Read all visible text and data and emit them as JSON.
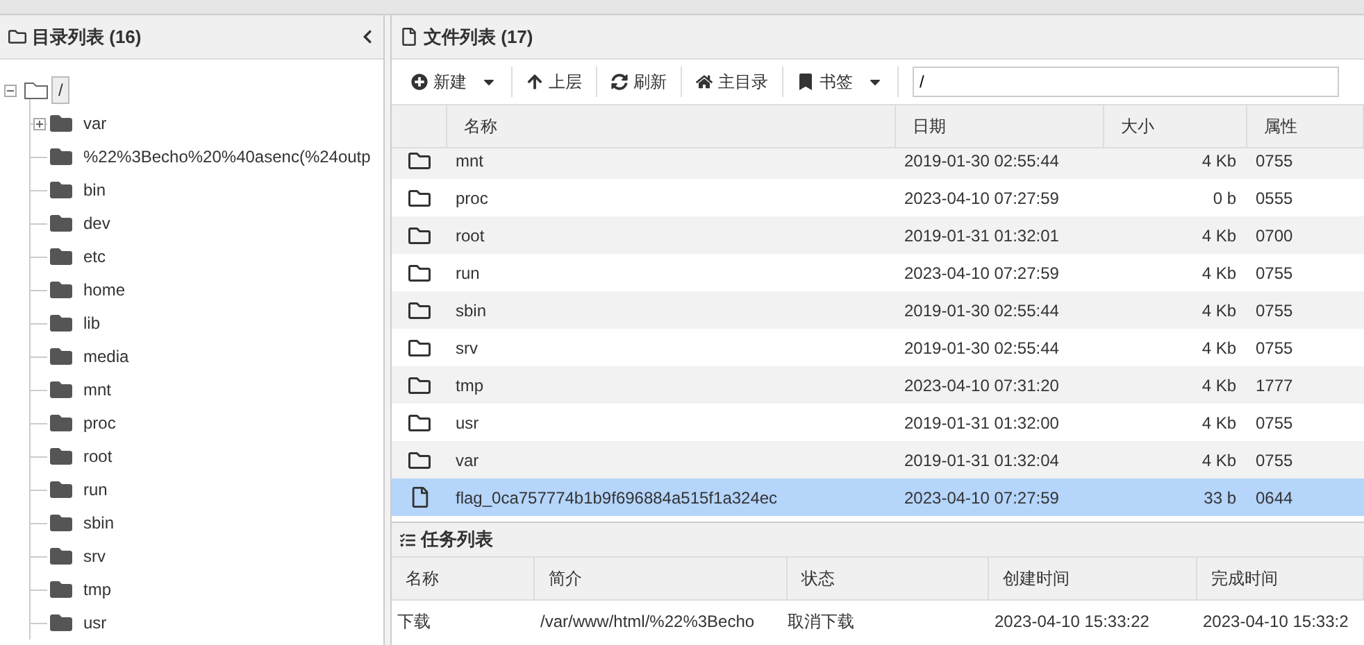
{
  "tree_panel": {
    "title": "目录列表 (16)",
    "root": {
      "label": "/",
      "expanded": true,
      "selected": true,
      "children": [
        {
          "label": "var",
          "kind": "collapsed"
        },
        {
          "label": "%22%3Becho%20%40asenc(%24outp",
          "kind": "leaf"
        },
        {
          "label": "bin",
          "kind": "leaf"
        },
        {
          "label": "dev",
          "kind": "leaf"
        },
        {
          "label": "etc",
          "kind": "leaf"
        },
        {
          "label": "home",
          "kind": "leaf"
        },
        {
          "label": "lib",
          "kind": "leaf"
        },
        {
          "label": "media",
          "kind": "leaf"
        },
        {
          "label": "mnt",
          "kind": "leaf"
        },
        {
          "label": "proc",
          "kind": "leaf"
        },
        {
          "label": "root",
          "kind": "leaf"
        },
        {
          "label": "run",
          "kind": "leaf"
        },
        {
          "label": "sbin",
          "kind": "leaf"
        },
        {
          "label": "srv",
          "kind": "leaf"
        },
        {
          "label": "tmp",
          "kind": "leaf"
        },
        {
          "label": "usr",
          "kind": "leaf"
        }
      ]
    }
  },
  "file_panel": {
    "title": "文件列表 (17)",
    "toolbar": [
      {
        "label": "新建",
        "kind": "new",
        "dropdown": true
      },
      {
        "label": "上层",
        "kind": "up",
        "dropdown": false
      },
      {
        "label": "刷新",
        "kind": "refresh",
        "dropdown": false
      },
      {
        "label": "主目录",
        "kind": "home",
        "dropdown": false
      },
      {
        "label": "书签",
        "kind": "bookmark",
        "dropdown": true
      }
    ],
    "path": "/",
    "columns": [
      "名称",
      "日期",
      "大小",
      "属性"
    ],
    "rows": [
      {
        "kind": "folder",
        "name": "mnt",
        "date": "2019-01-30 02:55:44",
        "size": "4 Kb",
        "mode": "0755",
        "selected": false
      },
      {
        "kind": "folder",
        "name": "proc",
        "date": "2023-04-10 07:27:59",
        "size": "0 b",
        "mode": "0555",
        "selected": false
      },
      {
        "kind": "folder",
        "name": "root",
        "date": "2019-01-31 01:32:01",
        "size": "4 Kb",
        "mode": "0700",
        "selected": false
      },
      {
        "kind": "folder",
        "name": "run",
        "date": "2023-04-10 07:27:59",
        "size": "4 Kb",
        "mode": "0755",
        "selected": false
      },
      {
        "kind": "folder",
        "name": "sbin",
        "date": "2019-01-30 02:55:44",
        "size": "4 Kb",
        "mode": "0755",
        "selected": false
      },
      {
        "kind": "folder",
        "name": "srv",
        "date": "2019-01-30 02:55:44",
        "size": "4 Kb",
        "mode": "0755",
        "selected": false
      },
      {
        "kind": "folder",
        "name": "tmp",
        "date": "2023-04-10 07:31:20",
        "size": "4 Kb",
        "mode": "1777",
        "selected": false
      },
      {
        "kind": "folder",
        "name": "usr",
        "date": "2019-01-31 01:32:00",
        "size": "4 Kb",
        "mode": "0755",
        "selected": false
      },
      {
        "kind": "folder",
        "name": "var",
        "date": "2019-01-31 01:32:04",
        "size": "4 Kb",
        "mode": "0755",
        "selected": false
      },
      {
        "kind": "file",
        "name": "flag_0ca757774b1b9f696884a515f1a324ec",
        "date": "2023-04-10 07:27:59",
        "size": "33 b",
        "mode": "0644",
        "selected": true
      }
    ]
  },
  "task_panel": {
    "title": "任务列表",
    "columns": [
      "名称",
      "简介",
      "状态",
      "创建时间",
      "完成时间"
    ],
    "rows": [
      [
        "下载",
        "/var/www/html/%22%3Becho",
        "取消下载",
        "2023-04-10 15:33:22",
        "2023-04-10 15:33:2"
      ]
    ]
  }
}
